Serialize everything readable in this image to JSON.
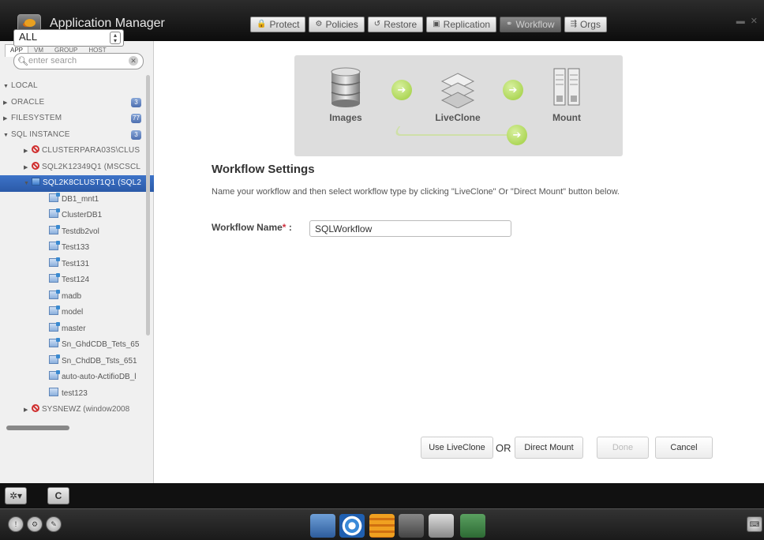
{
  "app": {
    "title": "Application Manager"
  },
  "nav": {
    "tabs": [
      {
        "label": "Protect",
        "icon": "lock-icon",
        "active": false
      },
      {
        "label": "Policies",
        "icon": "gear-icon",
        "active": false
      },
      {
        "label": "Restore",
        "icon": "restore-icon",
        "active": false
      },
      {
        "label": "Replication",
        "icon": "replication-icon",
        "active": false
      },
      {
        "label": "Workflow",
        "icon": "workflow-icon",
        "active": true
      },
      {
        "label": "Orgs",
        "icon": "orgs-icon",
        "active": false
      }
    ]
  },
  "sidebar": {
    "tabs": [
      "APP",
      "VM",
      "GROUP",
      "HOST"
    ],
    "filter_value": "ALL",
    "search_placeholder": "enter search",
    "tree": [
      {
        "label": "LOCAL",
        "caret": "▼",
        "indent": 4
      },
      {
        "label": "ORACLE",
        "caret": "▶",
        "indent": 4,
        "badge": "3"
      },
      {
        "label": "FILESYSTEM",
        "caret": "▶",
        "indent": 4,
        "badge": "77"
      },
      {
        "label": "SQL INSTANCE",
        "caret": "▼",
        "indent": 4,
        "badge": "3"
      },
      {
        "label": "CLUSTERPARA03S\\CLUS",
        "caret": "▶",
        "indent": 30,
        "icon": "no"
      },
      {
        "label": "SQL2K12349Q1 (MSCSCL",
        "caret": "▶",
        "indent": 30,
        "icon": "no"
      },
      {
        "label": "SQL2K8CLUST1Q1 (SQL2",
        "caret": "▼",
        "indent": 30,
        "icon": "server",
        "selected": true
      }
    ],
    "databases": [
      "DB1_mnt1",
      "ClusterDB1",
      "Testdb2vol",
      "Test133",
      "Test131",
      "Test124",
      "madb",
      "model",
      "master",
      "Sn_GhdCDB_Tets_65",
      "Sn_ChdDB_Tsts_651",
      "auto-auto-ActifioDB_l",
      "test123"
    ],
    "last_item": "SYSNEWZ (window2008"
  },
  "workflow": {
    "stages": {
      "images": "Images",
      "liveclone": "LiveClone",
      "mount": "Mount"
    },
    "title": "Workflow Settings",
    "description": "Name your workflow and then select workflow type by clicking \"LiveClone\" Or \"Direct Mount\" button below.",
    "name_label": "Workflow Name",
    "name_required_mark": "*",
    "name_colon": ":",
    "name_value": "SQLWorkflow",
    "buttons": {
      "use_liveclone": "Use LiveClone",
      "or": "OR",
      "direct_mount": "Direct Mount",
      "done": "Done",
      "cancel": "Cancel"
    }
  },
  "bottom": {
    "refresh_label": "C"
  }
}
